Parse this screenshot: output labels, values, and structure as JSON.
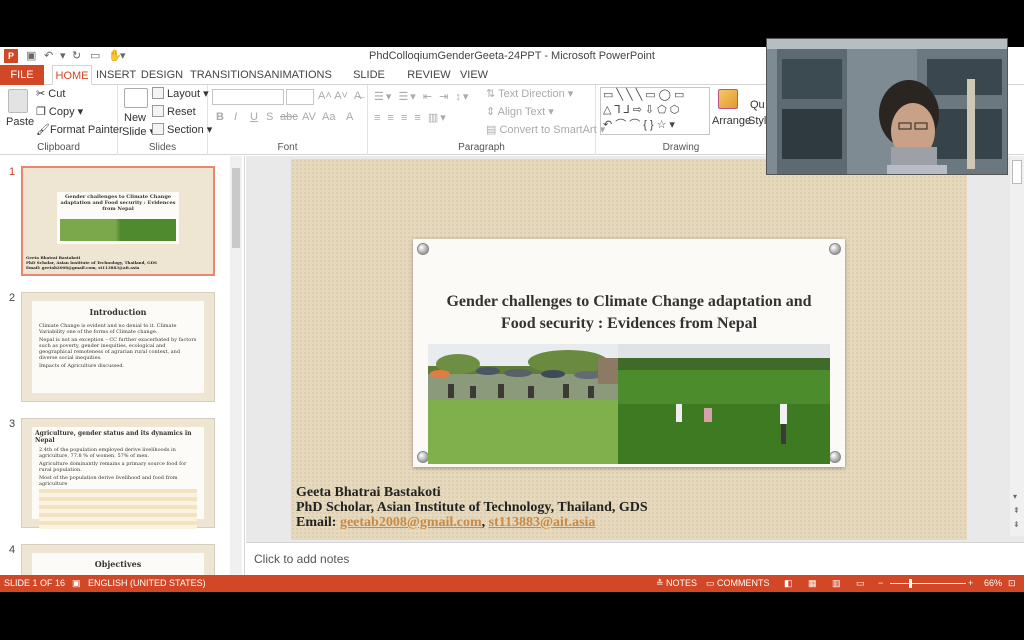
{
  "window": {
    "title": "PhdColloqiumGenderGeeta-24PPT - Microsoft PowerPoint",
    "app_badge": "P"
  },
  "tabs": [
    "FILE",
    "HOME",
    "INSERT",
    "DESIGN",
    "TRANSITIONS",
    "ANIMATIONS",
    "SLIDE SHOW",
    "REVIEW",
    "VIEW"
  ],
  "ribbon": {
    "clipboard": {
      "paste": "Paste",
      "cut": "Cut",
      "copy": "Copy",
      "format_painter": "Format Painter",
      "label": "Clipboard"
    },
    "slides": {
      "new_slide_1": "New",
      "new_slide_2": "Slide",
      "layout": "Layout",
      "reset": "Reset",
      "section": "Section",
      "label": "Slides"
    },
    "font": {
      "label": "Font",
      "bold": "B",
      "italic": "I",
      "underline": "U",
      "shadow": "S",
      "strike": "abc",
      "spacing": "AV",
      "case": "Aa",
      "color": "A"
    },
    "paragraph": {
      "text_direction": "Text Direction",
      "align_text": "Align Text",
      "convert_smartart": "Convert to SmartArt",
      "label": "Paragraph"
    },
    "drawing": {
      "arrange": "Arrange",
      "quick_styles_1": "Qu",
      "quick_styles_2": "Styl",
      "label": "Drawing"
    }
  },
  "thumbnails": [
    {
      "num": "1",
      "selected": true,
      "title": "Gender challenges to Climate Change adaptation and Food security : Evidences from Nepal",
      "footer_1": "Geeta Bhatrai Bastakoti",
      "footer_2": "PhD Scholar, Asian Institute of Technology, Thailand, GDS",
      "footer_3": "Email: geetab2008@gmail.com, st113883@ait.asia"
    },
    {
      "num": "2",
      "selected": false,
      "title": "Introduction",
      "bullets": [
        "Climate Change is evident and no denial to it. Climate Variability one of the forms of Climate change.",
        "Nepal is not an exception – CC further exacerbated by factors such as poverty, gender inequities, ecological and geographical remoteness of agrarian rural context, and diverse social inequities.",
        "Impacts of Agriculture discussed."
      ]
    },
    {
      "num": "3",
      "selected": false,
      "title": "Agriculture, gender status and its dynamics in Nepal",
      "bullets": [
        "2.4th of the population employed derive livelihoods in agriculture, 77.8 % of women, 57% of men.",
        "Agriculture dominantly remains a primary source food for rural population.",
        "Most of the population derive livelihood and food from agriculture"
      ]
    },
    {
      "num": "4",
      "selected": false,
      "title": "Objectives"
    }
  ],
  "slide": {
    "title_line1": "Gender challenges to Climate Change adaptation and",
    "title_line2": "Food security : Evidences from Nepal",
    "author": "Geeta Bhatrai Bastakoti",
    "affiliation": "PhD Scholar, Asian Institute of Technology, Thailand, GDS",
    "email_label": "Email: ",
    "email1": "geetab2008@gmail.com",
    "email_sep": ", ",
    "email2": "st113883@ait.asia"
  },
  "notes_placeholder": "Click to add notes",
  "status": {
    "slide_of": "SLIDE 1 OF 16",
    "language": "ENGLISH (UNITED STATES)",
    "notes": "NOTES",
    "comments": "COMMENTS",
    "zoom": "66%"
  },
  "colors": {
    "accent": "#d24726",
    "email": "#c88a45"
  }
}
